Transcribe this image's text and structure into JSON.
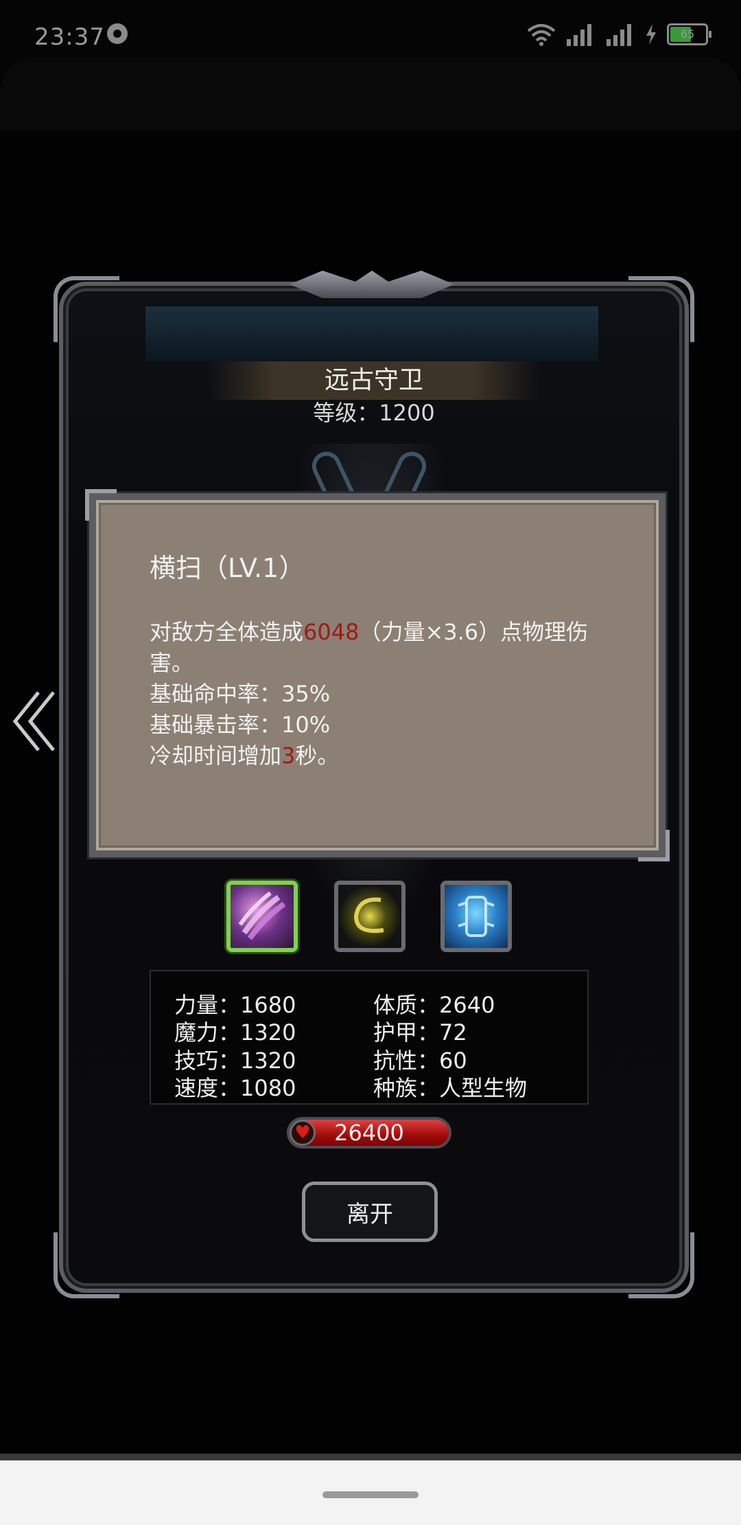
{
  "status_bar": {
    "time": "23:37",
    "battery": "65",
    "icons": [
      "notification-drop-icon",
      "wifi-icon",
      "signal-icon",
      "signal-icon",
      "charging-icon",
      "battery-icon"
    ]
  },
  "enemy": {
    "name": "远古守卫",
    "level_label": "等级：1200"
  },
  "skill_popup": {
    "title": "横扫（LV.1）",
    "desc_prefix": "对敌方全体造成",
    "damage_value": "6048",
    "desc_suffix": "（力量×3.6）点物理伤害。",
    "hit_rate": "基础命中率：35%",
    "crit_rate": "基础暴击率：10%",
    "cooldown_prefix": "冷却时间增加",
    "cooldown_value": "3",
    "cooldown_suffix": "秒。",
    "highlight_color": "#a01818"
  },
  "skills": [
    {
      "icon": "claw-slash-icon",
      "selected": true
    },
    {
      "icon": "lightning-arc-icon",
      "selected": false
    },
    {
      "icon": "blue-armor-icon",
      "selected": false
    }
  ],
  "stats": {
    "strength": "力量：1680",
    "constitution": "体质：2640",
    "magic": "魔力：1320",
    "armor": "护甲：72",
    "skill": "技巧：1320",
    "resistance": "抗性：60",
    "speed": "速度：1080",
    "race": "种族：人型生物"
  },
  "hp": {
    "value": "26400",
    "icon": "heart-icon"
  },
  "leave_button": {
    "label": "离开"
  },
  "nav": {
    "left_arrow_icon": "double-chevron-left-icon"
  }
}
